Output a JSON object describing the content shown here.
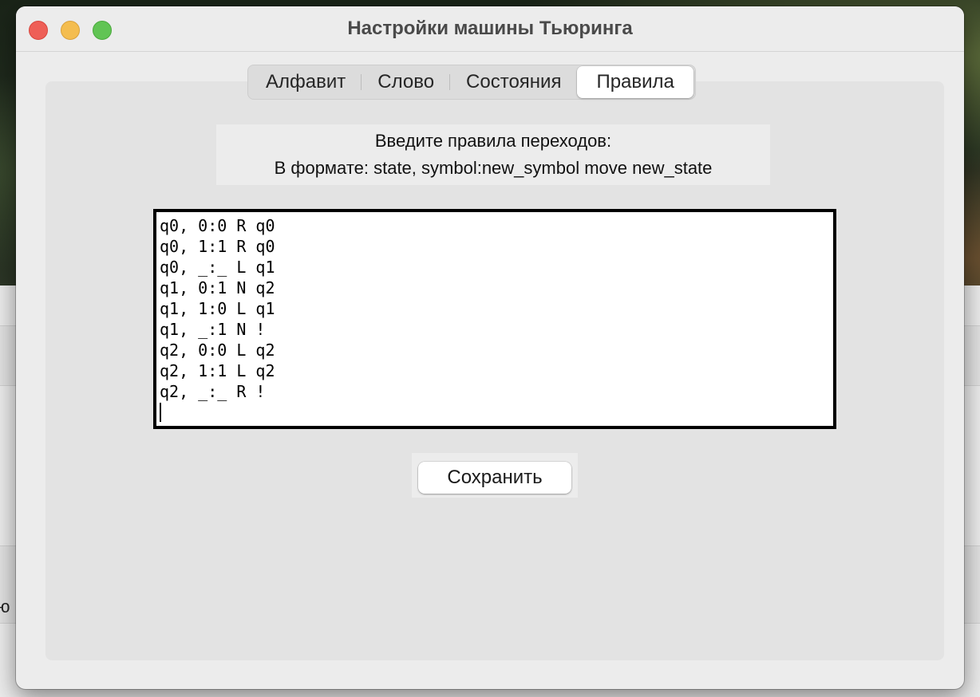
{
  "window": {
    "title": "Настройки машины Тьюринга"
  },
  "tabs": [
    {
      "label": "Алфавит",
      "active": false
    },
    {
      "label": "Слово",
      "active": false
    },
    {
      "label": "Состояния",
      "active": false
    },
    {
      "label": "Правила",
      "active": true
    }
  ],
  "instructions": {
    "line1": "Введите правила переходов:",
    "line2": "В формате: state, symbol:new_symbol move new_state"
  },
  "rules": [
    "q0, 0:0 R q0",
    "q0, 1:1 R q0",
    "q0, _:_ L q1",
    "q1, 0:1 N q2",
    "q1, 1:0 L q1",
    "q1, _:1 N !",
    "q2, 0:0 L q2",
    "q2, 1:1 L q2",
    "q2, _:_ R !"
  ],
  "save_button": {
    "label": "Сохранить"
  },
  "background": {
    "partial_text": "ю"
  },
  "colors": {
    "close": "#ee5f57",
    "minimize": "#f4bd4f",
    "zoom": "#61c454",
    "window_bg": "#ececec",
    "panel_bg": "#e3e3e3"
  }
}
